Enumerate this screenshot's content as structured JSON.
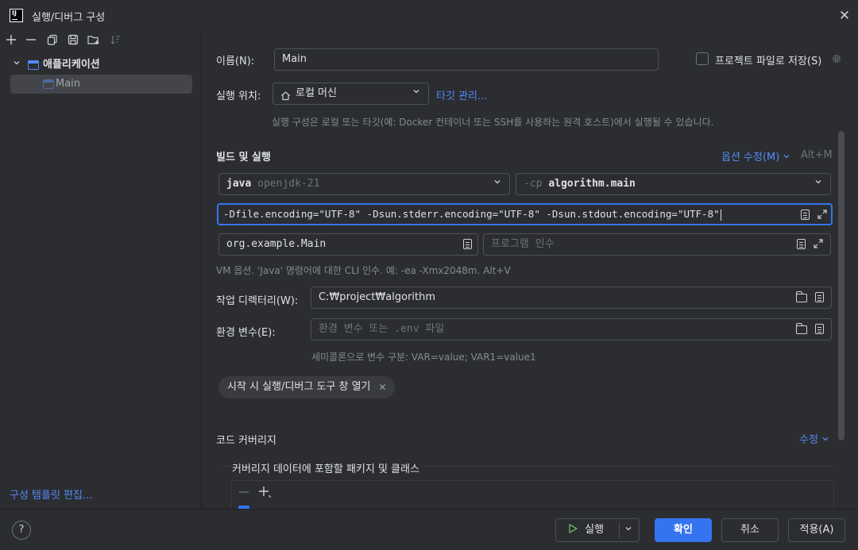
{
  "window": {
    "logo_text": "IJ",
    "title": "실행/디버그 구성",
    "close_glyph": "✕"
  },
  "left_toolbar": {
    "icons": [
      "add-icon",
      "remove-icon",
      "copy-icon",
      "save-icon",
      "folder-add-icon",
      "sort-icon"
    ]
  },
  "tree": {
    "group_label": "애플리케이션",
    "child_label": "Main"
  },
  "left_footer": {
    "template_link": "구성 템플릿 편집..."
  },
  "form": {
    "name_label": "이름(N):",
    "name_value": "Main",
    "store_project_label": "프로젝트 파일로 저장(S)",
    "run_on_label": "실행 위치:",
    "run_on_value": "로컬 머신",
    "manage_targets_link": "타깃 관리...",
    "run_on_hint": "실행 구성은 로컬 또는 타깃(예: Docker 컨테이너 또는 SSH를 사용하는 원격 호스트)에서 실행될 수 있습니다.",
    "build_run_title": "빌드 및 실행",
    "modify_options_link": "옵션 수정(M)",
    "modify_options_shortcut": "Alt+M",
    "jdk_name": "java",
    "jdk_version": "openjdk-21",
    "cp_prefix": "-cp",
    "cp_value": "algorithm.main",
    "vm_options_value": "-Dfile.encoding=\"UTF-8\" -Dsun.stderr.encoding=\"UTF-8\" -Dsun.stdout.encoding=\"UTF-8\"",
    "main_class_value": "org.example.Main",
    "program_args_placeholder": "프로그램 인수",
    "vm_hint": "VM 옵션. 'Java' 명령어에 대한 CLI 인수. 예: -ea -Xmx2048m. Alt+V",
    "workdir_label": "작업 디렉터리(W):",
    "workdir_value": "C:₩project₩algorithm",
    "env_label": "환경 변수(E):",
    "env_placeholder": "환경 변수 또는 .env 파일",
    "env_hint": "세미콜론으로 변수 구분: VAR=value; VAR1=value1",
    "tag_label": "시작 시 실행/디버그 도구 창 열기",
    "coverage_title": "코드 커버리지",
    "coverage_modify_link": "수정",
    "coverage_packages_label": "커버리지 데이터에 포함할 패키지 및 클래스"
  },
  "footer": {
    "help_glyph": "?",
    "run_label": "실행",
    "ok_label": "확인",
    "cancel_label": "취소",
    "apply_label": "적용(A)"
  },
  "colors": {
    "accent": "#3574f0",
    "link": "#548af7",
    "run_green": "#5fb865"
  }
}
